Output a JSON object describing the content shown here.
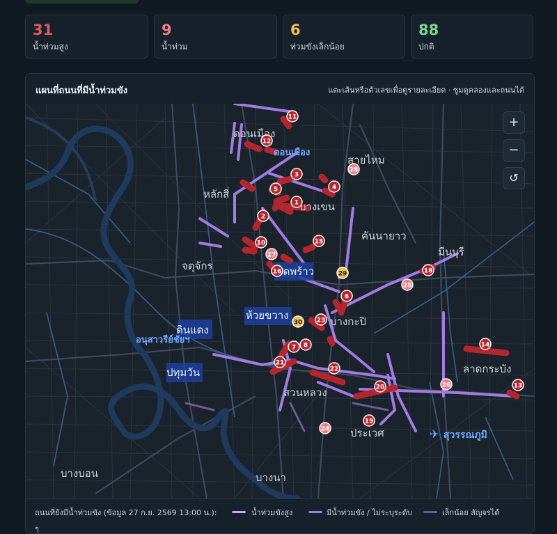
{
  "stats": [
    {
      "value": "31",
      "label": "น้ำท่วมสูง",
      "color": "#e05a5a"
    },
    {
      "value": "9",
      "label": "น้ำท่วม",
      "color": "#f07c8a"
    },
    {
      "value": "6",
      "label": "ท่วมขังเล็กน้อย",
      "color": "#f2c14e"
    },
    {
      "value": "88",
      "label": "ปกติ",
      "color": "#7dd38f"
    }
  ],
  "panel": {
    "title": "แผนที่ถนนที่มีน้ำท่วมขัง",
    "hint": "แตะเส้นหรือตัวเลขเพื่อดูรายละเอียด · ซูมดูคลองและถนนได้"
  },
  "controls": {
    "zoom_in": "+",
    "zoom_out": "−",
    "reset": "↺"
  },
  "map_labels": {
    "donmueang_area": "ดอนเมือง",
    "donmueang_airport": "ดอนเมือง",
    "saimai": "สายไหม",
    "laksi": "หลักสี่",
    "bangkhen": "บางเขน",
    "khannayao": "คันนายาว",
    "chatuchak": "จตุจักร",
    "ladprao": "ลาดพร้าว",
    "minburi": "มีนบุรี",
    "huaikhwang": "ห้วยขวาง",
    "bangkapi": "บางกะปิ",
    "dindaeng": "ดินแดง",
    "victory": "อนุสาวรีย์ชัยฯ",
    "pathumwan": "ปทุมวัน",
    "latkrabang": "ลาดกระบัง",
    "suanluang": "สวนหลวง",
    "prawet": "ประเวศ",
    "suvarnabhumi": "สุวรรณภูมิ",
    "bangbon": "บางบอน",
    "bangna": "บางนา"
  },
  "markers": [
    {
      "id": "11",
      "level": "high"
    },
    {
      "id": "12",
      "level": "high"
    },
    {
      "id": "3",
      "level": "high"
    },
    {
      "id": "28",
      "level": "medium"
    },
    {
      "id": "5",
      "level": "high"
    },
    {
      "id": "4",
      "level": "high"
    },
    {
      "id": "1",
      "level": "high"
    },
    {
      "id": "2",
      "level": "high"
    },
    {
      "id": "15",
      "level": "high"
    },
    {
      "id": "10",
      "level": "high"
    },
    {
      "id": "27",
      "level": "medium"
    },
    {
      "id": "16",
      "level": "high"
    },
    {
      "id": "29",
      "level": "low"
    },
    {
      "id": "18",
      "level": "high"
    },
    {
      "id": "25",
      "level": "medium"
    },
    {
      "id": "6",
      "level": "high"
    },
    {
      "id": "23",
      "level": "high"
    },
    {
      "id": "30",
      "level": "low"
    },
    {
      "id": "7",
      "level": "high"
    },
    {
      "id": "8",
      "level": "high"
    },
    {
      "id": "21",
      "level": "high"
    },
    {
      "id": "22",
      "level": "high"
    },
    {
      "id": "14",
      "level": "high"
    },
    {
      "id": "20",
      "level": "high"
    },
    {
      "id": "26",
      "level": "medium"
    },
    {
      "id": "13",
      "level": "high"
    },
    {
      "id": "24",
      "level": "medium"
    },
    {
      "id": "19",
      "level": "high"
    }
  ],
  "legend": {
    "title": "ถนนที่ยังมีน้ำท่วมขัง (ข้อมูล 27 ก.ย. 2569 13:00 น.):",
    "items": [
      {
        "label": "น้ำท่วมขังสูง",
        "color": "#c9a8f0"
      },
      {
        "label": "มีน้ำท่วมขัง / ไม่ระบุระดับ",
        "color": "#a27ce0"
      },
      {
        "label": "เล็กน้อย สัญจรได้",
        "color": "#6d5a9c"
      }
    ],
    "more": "ๆ"
  }
}
